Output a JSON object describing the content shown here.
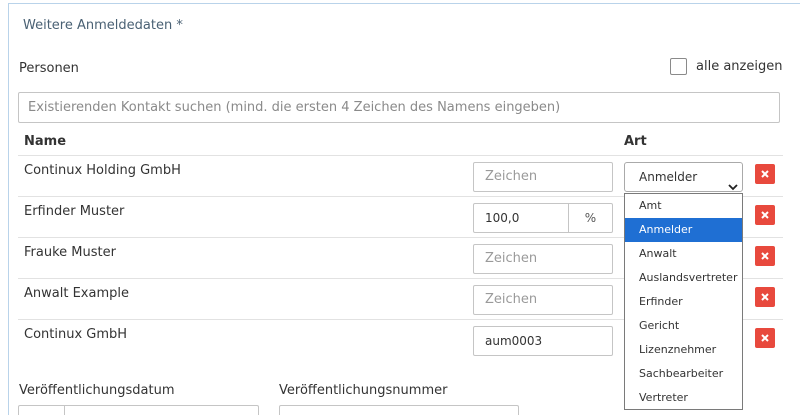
{
  "section": {
    "title": "Weitere Anmeldedaten *"
  },
  "persons": {
    "label": "Personen",
    "show_all_label": "alle anzeigen",
    "show_all_checked": false,
    "search_placeholder": "Existierenden Kontakt suchen (mind. die ersten 4 Zeichen des Namens eingeben)",
    "columns": {
      "name": "Name",
      "type": "Art"
    },
    "rows": [
      {
        "name": "Continux Holding GmbH",
        "field_placeholder": "Zeichen",
        "field_value": ""
      },
      {
        "name": "Erfinder Muster",
        "field_value": "100,0",
        "field_unit": "%"
      },
      {
        "name": "Frauke Muster",
        "field_placeholder": "Zeichen",
        "field_value": ""
      },
      {
        "name": "Anwalt Example",
        "field_placeholder": "Zeichen",
        "field_value": ""
      },
      {
        "name": "Continux GmbH",
        "field_value": "aum0003"
      }
    ],
    "type_select": {
      "value": "Anmelder",
      "options": [
        "Amt",
        "Anmelder",
        "Anwalt",
        "Auslandsvertreter",
        "Erfinder",
        "Gericht",
        "Lizenznehmer",
        "Sachbearbeiter",
        "Vertreter"
      ],
      "highlighted": "Anmelder"
    }
  },
  "publication": {
    "date_label": "Veröffentlichungsdatum",
    "number_label": "Veröffentlichungsnummer"
  },
  "icons": {
    "delete": "delete-x-icon",
    "chevron": "chevron-down-icon",
    "calendar": "calendar-icon"
  },
  "colors": {
    "accent": "#1f6fd3",
    "delete": "#e8493d",
    "panel_border": "#b9d3ea",
    "title": "#4a6174"
  }
}
